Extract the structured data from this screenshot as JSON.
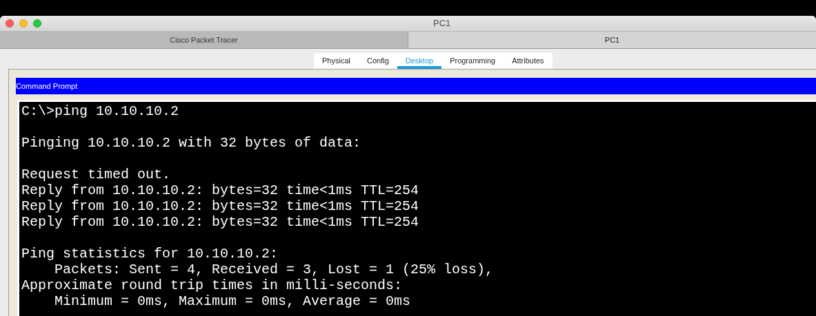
{
  "window": {
    "title": "PC1"
  },
  "window_tabs": [
    {
      "label": "Cisco Packet Tracer",
      "selected": false
    },
    {
      "label": "PC1",
      "selected": true
    }
  ],
  "tabs": [
    {
      "label": "Physical",
      "selected": false
    },
    {
      "label": "Config",
      "selected": false
    },
    {
      "label": "Desktop",
      "selected": true
    },
    {
      "label": "Programming",
      "selected": false
    },
    {
      "label": "Attributes",
      "selected": false
    }
  ],
  "panel": {
    "title": "Command Prompt"
  },
  "terminal": {
    "blocks": [
      [
        "C:\\>ping 10.10.10.2"
      ],
      [
        "Pinging 10.10.10.2 with 32 bytes of data:"
      ],
      [
        "Request timed out.",
        "Reply from 10.10.10.2: bytes=32 time<1ms TTL=254",
        "Reply from 10.10.10.2: bytes=32 time<1ms TTL=254",
        "Reply from 10.10.10.2: bytes=32 time<1ms TTL=254"
      ],
      [
        "Ping statistics for 10.10.10.2:",
        "    Packets: Sent = 4, Received = 3, Lost = 1 (25% loss),",
        "Approximate round trip times in milli-seconds:",
        "    Minimum = 0ms, Maximum = 0ms, Average = 0ms"
      ]
    ]
  }
}
